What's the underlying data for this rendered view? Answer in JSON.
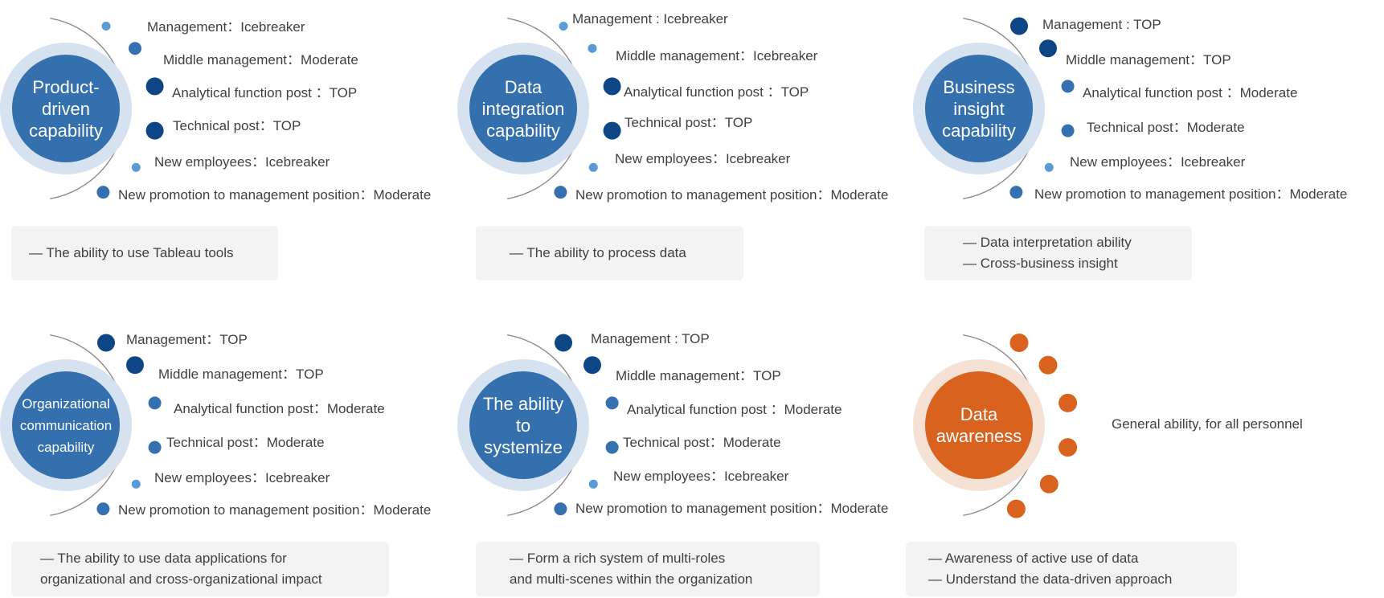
{
  "colors": {
    "top": "#0d4585",
    "moderate": "#3570b0",
    "icebreaker": "#5a9ad6",
    "center_blue": "#3570ae",
    "halo_blue": "#d6e2ef",
    "center_orange": "#d9621e",
    "halo_orange": "#f6e1d5",
    "arc": "#8c8c8c",
    "box_bg": "#f3f3f3"
  },
  "panels": [
    {
      "title_lines": [
        "Product-",
        "driven",
        "capability"
      ],
      "theme": "blue",
      "items": [
        {
          "label": "Management：Icebreaker",
          "level": "Icebreaker"
        },
        {
          "label": "Middle management：Moderate",
          "level": "Moderate"
        },
        {
          "label": "Analytical function post ：TOP",
          "level": "TOP"
        },
        {
          "label": "Technical post：TOP",
          "level": "TOP"
        },
        {
          "label": "New employees：Icebreaker",
          "level": "Icebreaker"
        },
        {
          "label": "New promotion to management position：Moderate",
          "level": "Moderate"
        }
      ],
      "description": [
        "— The ability to use Tableau tools"
      ]
    },
    {
      "title_lines": [
        "Data",
        "integration",
        "capability"
      ],
      "theme": "blue",
      "items": [
        {
          "label": "Management : Icebreaker",
          "level": "Icebreaker"
        },
        {
          "label": "Middle management：Icebreaker",
          "level": "Icebreaker"
        },
        {
          "label": "Analytical function post ：TOP",
          "level": "TOP"
        },
        {
          "label": "Technical post：TOP",
          "level": "TOP"
        },
        {
          "label": "New employees：Icebreaker",
          "level": "Icebreaker"
        },
        {
          "label": "New promotion to management position：Moderate",
          "level": "Moderate"
        }
      ],
      "description": [
        "— The ability to process data"
      ]
    },
    {
      "title_lines": [
        "Business",
        "insight",
        "capability"
      ],
      "theme": "blue",
      "items": [
        {
          "label": "Management : TOP",
          "level": "TOP"
        },
        {
          "label": "Middle management：TOP",
          "level": "TOP"
        },
        {
          "label": "Analytical function post ：Moderate",
          "level": "Moderate"
        },
        {
          "label": "Technical post：Moderate",
          "level": "Moderate"
        },
        {
          "label": "New employees：Icebreaker",
          "level": "Icebreaker"
        },
        {
          "label": "New promotion to management position：Moderate",
          "level": "Moderate"
        }
      ],
      "description": [
        "— Data interpretation ability",
        "— Cross-business insight"
      ]
    },
    {
      "title_lines": [
        "Organizational",
        "communication",
        "capability"
      ],
      "theme": "blue",
      "items": [
        {
          "label": "Management：TOP",
          "level": "TOP"
        },
        {
          "label": "Middle management：TOP",
          "level": "TOP"
        },
        {
          "label": "Analytical function post：Moderate",
          "level": "Moderate"
        },
        {
          "label": "Technical post：Moderate",
          "level": "Moderate"
        },
        {
          "label": "New employees：Icebreaker",
          "level": "Icebreaker"
        },
        {
          "label": "New promotion to management position：Moderate",
          "level": "Moderate"
        }
      ],
      "description": [
        "— The ability to use data applications for",
        "organizational and cross-organizational impact"
      ]
    },
    {
      "title_lines": [
        "The ability",
        "to",
        "systemize"
      ],
      "theme": "blue",
      "items": [
        {
          "label": "Management : TOP",
          "level": "TOP"
        },
        {
          "label": "Middle management：TOP",
          "level": "TOP"
        },
        {
          "label": "Analytical function post ：Moderate",
          "level": "Moderate"
        },
        {
          "label": "Technical post：Moderate",
          "level": "Moderate"
        },
        {
          "label": "New employees：Icebreaker",
          "level": "Icebreaker"
        },
        {
          "label": "New promotion to management position：Moderate",
          "level": "Moderate"
        }
      ],
      "description": [
        "— Form a rich system of multi-roles",
        "and multi-scenes within the organization"
      ]
    },
    {
      "title_lines": [
        "Data",
        "awareness"
      ],
      "theme": "orange",
      "items": [
        {
          "label": "",
          "level": "All"
        },
        {
          "label": "",
          "level": "All"
        },
        {
          "label": "",
          "level": "All"
        },
        {
          "label": "",
          "level": "All"
        },
        {
          "label": "",
          "level": "All"
        },
        {
          "label": "",
          "level": "All"
        }
      ],
      "side_note": "General ability, for all personnel",
      "description": [
        "— Awareness of active use of data",
        "— Understand the data-driven approach"
      ]
    }
  ]
}
